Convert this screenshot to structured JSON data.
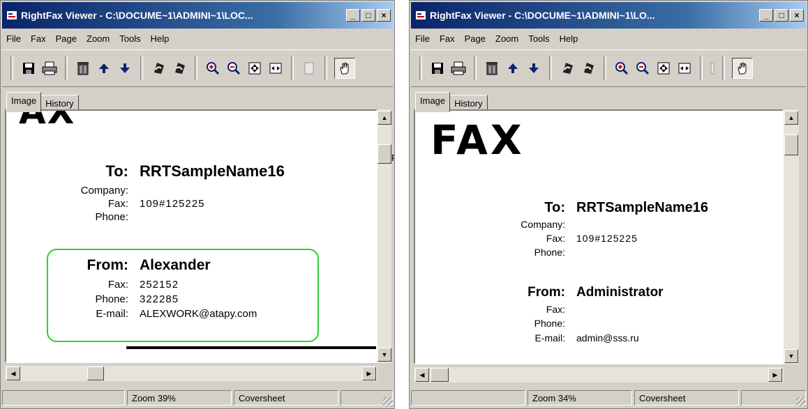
{
  "menu": [
    "File",
    "Fax",
    "Page",
    "Zoom",
    "Tools",
    "Help"
  ],
  "tabs": [
    "Image",
    "History"
  ],
  "left": {
    "title": "RightFax Viewer - C:\\DOCUME~1\\ADMINI~1\\LOC...",
    "doc": {
      "logo": "AX",
      "to_label": "To:",
      "to_value": "RRTSampleName16",
      "company_label": "Company:",
      "company_value": "",
      "fax_label": "Fax:",
      "fax_value": "109#125225",
      "phone_label": "Phone:",
      "phone_value": "",
      "from_label": "From:",
      "from_value": "Alexander",
      "from_fax_label": "Fax:",
      "from_fax_value": "252152",
      "from_phone_label": "Phone:",
      "from_phone_value": "322285",
      "email_label": "E-mail:",
      "email_value": "ALEXWORK@atapy.com"
    },
    "status": {
      "zoom": "Zoom 39%",
      "page": "Coversheet"
    },
    "side_tab": "F"
  },
  "right": {
    "title": "RightFax Viewer - C:\\DOCUME~1\\ADMINI~1\\LO...",
    "doc": {
      "logo": "FAX",
      "to_label": "To:",
      "to_value": "RRTSampleName16",
      "company_label": "Company:",
      "company_value": "",
      "fax_label": "Fax:",
      "fax_value": "109#125225",
      "phone_label": "Phone:",
      "phone_value": "",
      "from_label": "From:",
      "from_value": "Administrator",
      "from_fax_label": "Fax:",
      "from_fax_value": "",
      "from_phone_label": "Phone:",
      "from_phone_value": "",
      "email_label": "E-mail:",
      "email_value": "admin@sss.ru"
    },
    "status": {
      "zoom": "Zoom 34%",
      "page": "Coversheet"
    }
  },
  "window_controls": {
    "minimize": "_",
    "maximize": "□",
    "close": "×"
  },
  "colors": {
    "titlebar": "#0a246a",
    "chrome": "#d4d0c8",
    "from_box_border": "#33cc33"
  },
  "icons": [
    "save-icon",
    "print-icon",
    "delete-icon",
    "up-arrow-icon",
    "down-arrow-icon",
    "rotate-left-icon",
    "rotate-right-icon",
    "zoom-in-icon",
    "zoom-out-icon",
    "fit-page-icon",
    "fit-width-icon",
    "hand-tool-icon"
  ]
}
